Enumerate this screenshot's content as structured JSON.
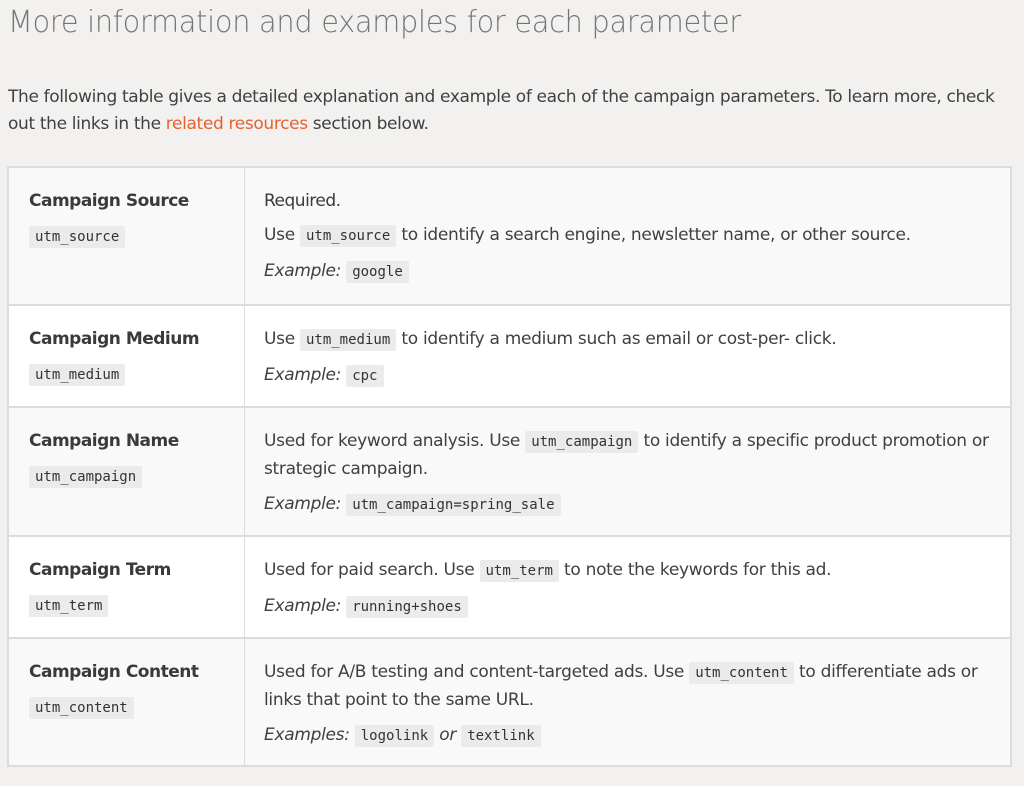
{
  "heading": "More information and examples for each parameter",
  "intro": {
    "before_link": "The following table gives a detailed explanation and example of each of the campaign parameters. To learn more, check out the links in the ",
    "link_text": "related resources",
    "after_link": " section below.",
    "link_color": "#e8602e"
  },
  "rows": [
    {
      "name": "Campaign Source",
      "param": "utm_source",
      "required": "Required.",
      "desc_before": "Use ",
      "desc_code": "utm_source",
      "desc_after": " to identify a search engine, newsletter name, or other source.",
      "example_label": "Example:",
      "example_values": [
        "google"
      ]
    },
    {
      "name": "Campaign Medium",
      "param": "utm_medium",
      "desc_before": "Use ",
      "desc_code": "utm_medium",
      "desc_after": " to identify a medium such as email or cost-per- click.",
      "example_label": "Example:",
      "example_values": [
        "cpc"
      ]
    },
    {
      "name": "Campaign Name",
      "param": "utm_campaign",
      "desc_before": "Used for keyword analysis. Use ",
      "desc_code": "utm_campaign",
      "desc_after": " to identify a specific product promotion or strategic campaign.",
      "example_label": "Example:",
      "example_values": [
        "utm_campaign=spring_sale"
      ]
    },
    {
      "name": "Campaign Term",
      "param": "utm_term",
      "desc_before": "Used for paid search. Use ",
      "desc_code": "utm_term",
      "desc_after": " to note the keywords for this ad.",
      "example_label": "Example:",
      "example_values": [
        "running+shoes"
      ]
    },
    {
      "name": "Campaign Content",
      "param": "utm_content",
      "desc_before": "Used for A/B testing and content-targeted ads. Use ",
      "desc_code": "utm_content",
      "desc_after": " to differentiate ads or links that point to the same URL.",
      "example_label": "Examples:",
      "example_values": [
        "logolink",
        "textlink"
      ],
      "example_joiner": "or"
    }
  ]
}
